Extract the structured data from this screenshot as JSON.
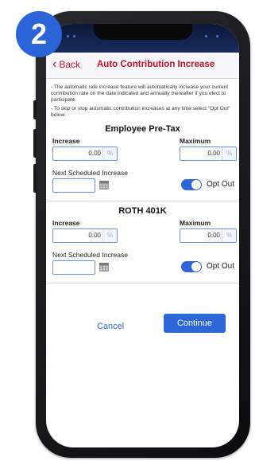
{
  "step": {
    "number": "2",
    "color": "#2b63d9"
  },
  "nav": {
    "back_label": "Back",
    "title": "Auto Contribution Increase",
    "accent_color": "#c8102e"
  },
  "info": {
    "line1": "- The automatic rate increase feature will automatically increase your current contribution rate on the date indicated and annually thereafter if you elect to participate.",
    "line2": "- To skip or stop automatic contribution increases at any time select \"Opt Out\" below."
  },
  "sections": [
    {
      "title": "Employee Pre-Tax",
      "increase_label": "Increase",
      "increase_value": "0.00",
      "maximum_label": "Maximum",
      "maximum_value": "0.00",
      "unit": "%",
      "next_label": "Next Scheduled Increase",
      "next_value": "",
      "opt_out_label": "Opt Out",
      "opt_out_on": true
    },
    {
      "title": "ROTH 401K",
      "increase_label": "Increase",
      "increase_value": "0.00",
      "maximum_label": "Maximum",
      "maximum_value": "0.00",
      "unit": "%",
      "next_label": "Next Scheduled Increase",
      "next_value": "",
      "opt_out_label": "Opt Out",
      "opt_out_on": true
    }
  ],
  "actions": {
    "cancel_label": "Cancel",
    "continue_label": "Continue",
    "primary_color": "#2d66d6"
  },
  "icons": {
    "back": "chevron-left-icon",
    "calendar": "calendar-icon"
  }
}
